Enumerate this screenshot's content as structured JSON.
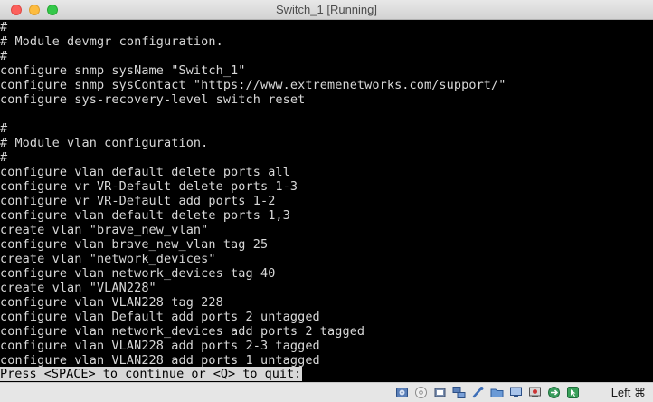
{
  "window": {
    "title": "Switch_1 [Running]"
  },
  "terminal": {
    "lines": [
      "#",
      "# Module devmgr configuration.",
      "#",
      "configure snmp sysName \"Switch_1\"",
      "configure snmp sysContact \"https://www.extremenetworks.com/support/\"",
      "configure sys-recovery-level switch reset",
      "",
      "#",
      "# Module vlan configuration.",
      "#",
      "configure vlan default delete ports all",
      "configure vr VR-Default delete ports 1-3",
      "configure vr VR-Default add ports 1-2",
      "configure vlan default delete ports 1,3",
      "create vlan \"brave_new_vlan\"",
      "configure vlan brave_new_vlan tag 25",
      "create vlan \"network_devices\"",
      "configure vlan network_devices tag 40",
      "create vlan \"VLAN228\"",
      "configure vlan VLAN228 tag 228",
      "configure vlan Default add ports 2 untagged",
      "configure vlan network_devices add ports 2 tagged",
      "configure vlan VLAN228 add ports 2-3 tagged",
      "configure vlan VLAN228 add ports 1 untagged"
    ],
    "prompt": "Press <SPACE> to continue or <Q> to quit:"
  },
  "statusbar": {
    "icons": [
      "hard-disk-icon",
      "optical-drive-icon",
      "audio-icon",
      "network-icon",
      "usb-icon",
      "shared-folder-icon",
      "display-icon",
      "recording-icon",
      "drag-drop-icon",
      "mouse-integration-icon"
    ],
    "host_key": "Left ⌘"
  },
  "colors": {
    "terminal_bg": "#000000",
    "terminal_fg": "#d8d8d8",
    "titlebar": "#dcdcdc"
  }
}
